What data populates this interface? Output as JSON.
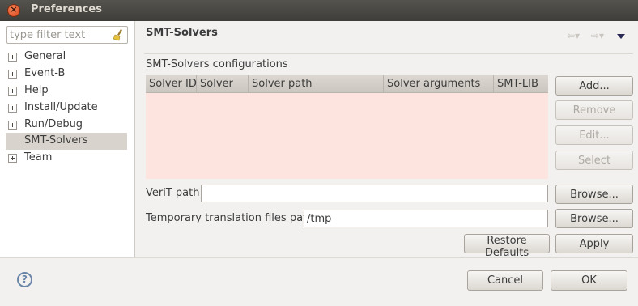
{
  "window": {
    "title": "Preferences",
    "close_glyph": "×"
  },
  "sidebar": {
    "filter_placeholder": "type filter text",
    "items": [
      {
        "label": "General",
        "expandable": true
      },
      {
        "label": "Event-B",
        "expandable": true
      },
      {
        "label": "Help",
        "expandable": true
      },
      {
        "label": "Install/Update",
        "expandable": true
      },
      {
        "label": "Run/Debug",
        "expandable": true
      },
      {
        "label": "SMT-Solvers",
        "expandable": false,
        "selected": true
      },
      {
        "label": "Team",
        "expandable": true
      }
    ]
  },
  "page": {
    "title": "SMT-Solvers",
    "nav": {
      "back_glyph": "⇦▾",
      "forward_glyph": "⇨▾"
    },
    "configurations_label": "SMT-Solvers configurations",
    "table": {
      "columns": [
        "Solver ID",
        "Solver",
        "Solver path",
        "Solver arguments",
        "SMT-LIB"
      ],
      "rows": [],
      "background_color": "#fde4df"
    },
    "buttons": {
      "add": "Add...",
      "remove": "Remove",
      "edit": "Edit...",
      "select": "Select",
      "browse_verit": "Browse...",
      "browse_temp": "Browse...",
      "restore_defaults": "Restore Defaults",
      "apply": "Apply"
    },
    "verit_path": {
      "label": "VeriT path",
      "value": ""
    },
    "temp_path": {
      "label": "Temporary translation files path",
      "value": "/tmp"
    }
  },
  "footer": {
    "help_glyph": "?",
    "cancel": "Cancel",
    "ok": "OK"
  },
  "colors": {
    "titlebar": "#3e3d39",
    "close_button": "#d9431a",
    "selection": "#d8d3cc",
    "window_bg": "#f2f1f0"
  }
}
